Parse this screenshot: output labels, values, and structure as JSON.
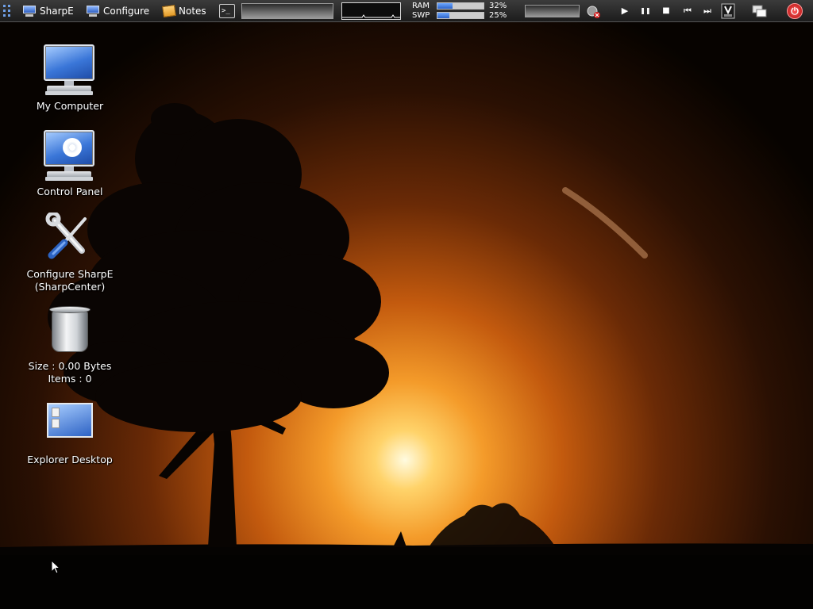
{
  "taskbar": {
    "buttons": [
      {
        "label": "SharpE",
        "icon": "monitor-icon"
      },
      {
        "label": "Configure",
        "icon": "monitor-icon"
      },
      {
        "label": "Notes",
        "icon": "notes-icon"
      }
    ],
    "terminal_glyph": ">_",
    "memory": {
      "ram_label": "RAM",
      "ram_percent": "32%",
      "ram_value": 0.32,
      "swap_label": "SWP",
      "swap_percent": "25%",
      "swap_value": 0.25
    },
    "media_controls": {
      "play": "▶",
      "pause": "❚❚",
      "stop": "■",
      "previous": "⏮",
      "next": "⏭"
    },
    "power_glyph": "⏻"
  },
  "desktop": {
    "icons": [
      {
        "label": "My Computer"
      },
      {
        "label": "Control Panel"
      },
      {
        "label_line1": "Configure SharpE",
        "label_line2": "(SharpCenter)"
      },
      {
        "label_line1": "Size : 0.00 Bytes",
        "label_line2": "Items : 0"
      },
      {
        "label": "Explorer Desktop"
      }
    ]
  },
  "colors": {
    "taskbar": "#2a2a2a",
    "accent_blue": "#2d63c8",
    "sunset_orange": "#e06a10"
  }
}
